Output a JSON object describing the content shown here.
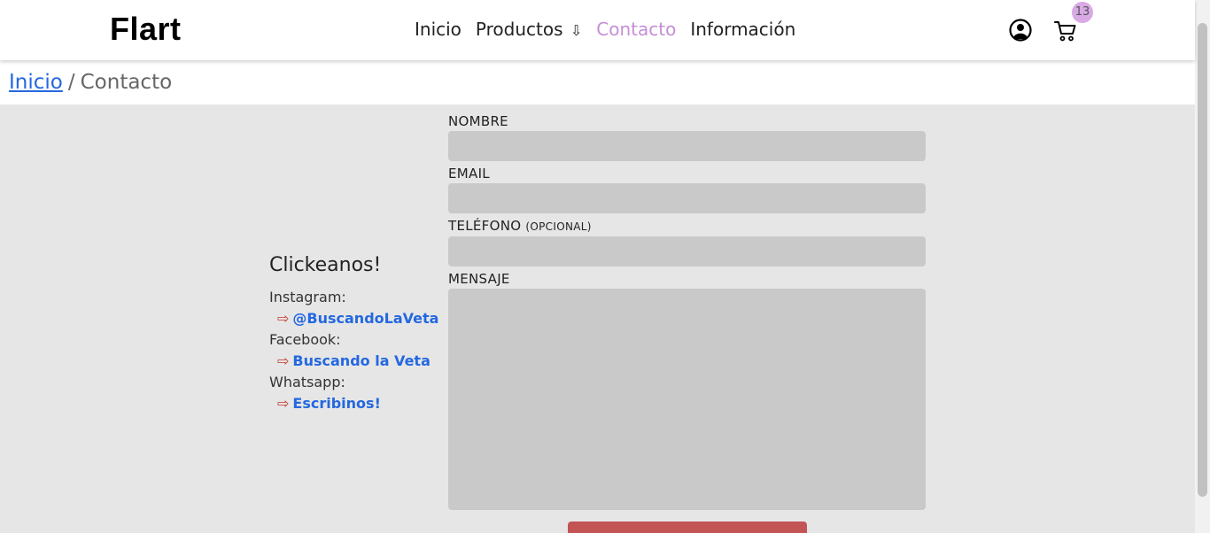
{
  "header": {
    "logo": "Flart",
    "nav": [
      {
        "label": "Inicio"
      },
      {
        "label": "Productos",
        "arrow": "⇩"
      },
      {
        "label": "Contacto",
        "active": true
      },
      {
        "label": "Información"
      }
    ],
    "cart_count": "13",
    "icons": [
      "user-icon",
      "cart-icon"
    ]
  },
  "breadcrumb": {
    "home": "Inicio",
    "separator": "/",
    "current": "Contacto"
  },
  "social": {
    "title": "Clickeanos!",
    "items": [
      {
        "label": "Instagram:",
        "arrow": "⇨",
        "link": "@BuscandoLaVeta"
      },
      {
        "label": "Facebook:",
        "arrow": "⇨",
        "link": "Buscando la Veta"
      },
      {
        "label": "Whatsapp:",
        "arrow": "⇨",
        "link": "Escribinos!"
      }
    ]
  },
  "form": {
    "name_label": "NOMBRE",
    "email_label": "EMAIL",
    "phone_label": "TELÉFONO",
    "phone_optional": "(OPCIONAL)",
    "message_label": "MENSAJE",
    "name_value": "",
    "email_value": "",
    "phone_value": "",
    "message_value": ""
  },
  "colors": {
    "accent": "#c58ed6",
    "link": "#2468e0",
    "button": "#c25454",
    "background": "#e6e6e6"
  }
}
